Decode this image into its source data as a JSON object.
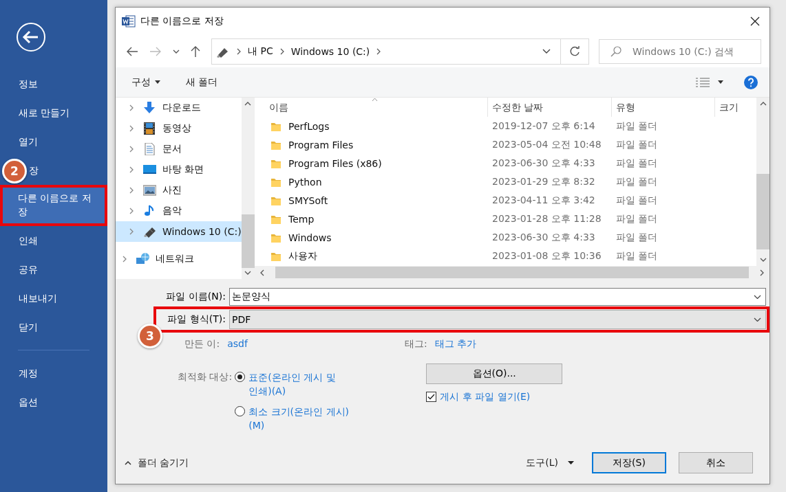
{
  "backstage": {
    "items": [
      {
        "label": "정보",
        "selected": false,
        "highlighted": false
      },
      {
        "label": "새로 만들기",
        "selected": false,
        "highlighted": false
      },
      {
        "label": "열기",
        "selected": false,
        "highlighted": false
      },
      {
        "label": "장",
        "selected": false,
        "highlighted": false,
        "badge": "2"
      },
      {
        "label": "다른 이름으로 저장",
        "selected": true,
        "highlighted": true
      },
      {
        "label": "인쇄",
        "selected": false,
        "highlighted": false
      },
      {
        "label": "공유",
        "selected": false,
        "highlighted": false
      },
      {
        "label": "내보내기",
        "selected": false,
        "highlighted": false
      },
      {
        "label": "닫기",
        "selected": false,
        "highlighted": false
      }
    ],
    "bottom_items": [
      {
        "label": "계정",
        "selected": false,
        "highlighted": false
      },
      {
        "label": "옵션",
        "selected": false,
        "highlighted": false
      }
    ]
  },
  "dialog": {
    "title": "다른 이름으로 저장",
    "path": [
      "내 PC",
      "Windows 10 (C:)"
    ],
    "search_placeholder": "Windows 10 (C:) 검색",
    "toolbar": {
      "organize": "구성",
      "new_folder": "새 폴더"
    },
    "tree": [
      {
        "label": "다운로드",
        "kind": "download",
        "selected": false
      },
      {
        "label": "동영상",
        "kind": "video",
        "selected": false
      },
      {
        "label": "문서",
        "kind": "document",
        "selected": false
      },
      {
        "label": "바탕 화면",
        "kind": "desktop",
        "selected": false
      },
      {
        "label": "사진",
        "kind": "pictures",
        "selected": false
      },
      {
        "label": "음악",
        "kind": "music",
        "selected": false
      },
      {
        "label": "Windows 10 (C:)",
        "kind": "drive",
        "selected": true
      },
      {
        "label": "네트워크",
        "kind": "network",
        "selected": false
      }
    ],
    "columns": [
      "이름",
      "수정한 날짜",
      "유형",
      "크기"
    ],
    "files": [
      {
        "name": "PerfLogs",
        "modified": "2019-12-07 오후 6:14",
        "type": "파일 폴더"
      },
      {
        "name": "Program Files",
        "modified": "2023-05-04 오전 10:48",
        "type": "파일 폴더"
      },
      {
        "name": "Program Files (x86)",
        "modified": "2023-06-30 오후 4:33",
        "type": "파일 폴더"
      },
      {
        "name": "Python",
        "modified": "2023-01-29 오후 8:32",
        "type": "파일 폴더"
      },
      {
        "name": "SMYSoft",
        "modified": "2023-04-11 오후 3:42",
        "type": "파일 폴더"
      },
      {
        "name": "Temp",
        "modified": "2023-01-28 오후 11:28",
        "type": "파일 폴더"
      },
      {
        "name": "Windows",
        "modified": "2023-06-30 오후 4:33",
        "type": "파일 폴더"
      },
      {
        "name": "사용자",
        "modified": "2023-01-08 오후 10:36",
        "type": "파일 폴더"
      }
    ],
    "file_name": {
      "label": "파일 이름(N):",
      "value": "논문양식"
    },
    "file_type": {
      "label": "파일 형식(T):",
      "value": "PDF",
      "highlighted": true,
      "badge": "3"
    },
    "author": {
      "label": "만든 이:",
      "value": "asdf"
    },
    "tags": {
      "label": "태그:",
      "value": "태그 추가"
    },
    "optimize": {
      "label": "최적화 대상:",
      "options": [
        {
          "label": "표준(온라인 게시 및 인쇄)(A)",
          "selected": true
        },
        {
          "label": "최소 크기(온라인 게시)(M)",
          "selected": false
        }
      ]
    },
    "options_button": "옵션(O)...",
    "open_after": {
      "label": "게시 후 파일 열기(E)",
      "checked": true
    },
    "hide_folders": "폴더 숨기기",
    "tools": "도구(L)",
    "save": "저장(S)",
    "cancel": "취소"
  }
}
